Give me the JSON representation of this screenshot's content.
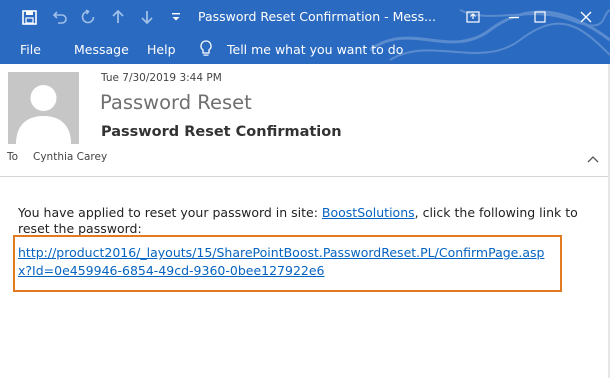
{
  "window": {
    "title": "Password Reset Confirmation  -  Mess...",
    "accent_color": "#2a6ac1"
  },
  "quick_access": {
    "icons": [
      "save-icon",
      "undo-icon",
      "redo-icon",
      "up-arrow-icon",
      "down-arrow-icon",
      "customize-icon"
    ]
  },
  "ribbon": {
    "tabs": [
      "File",
      "Message",
      "Help"
    ],
    "tell_me": "Tell me what you want to do"
  },
  "email": {
    "date": "Tue 7/30/2019 3:44 PM",
    "sender": "Password Reset",
    "subject": "Password Reset Confirmation",
    "to_label": "To",
    "to_name": "Cynthia Carey",
    "body_prefix": "You have applied to reset your password in site: ",
    "site_link": "BoostSolutions",
    "body_suffix": ", click the following link to reset the password:",
    "reset_url": "http://product2016/_layouts/15/SharePointBoost.PasswordReset.PL/ConfirmPage.aspx?Id=0e459946-6854-49cd-9360-0bee127922e6",
    "highlight_color": "#e07b22"
  }
}
